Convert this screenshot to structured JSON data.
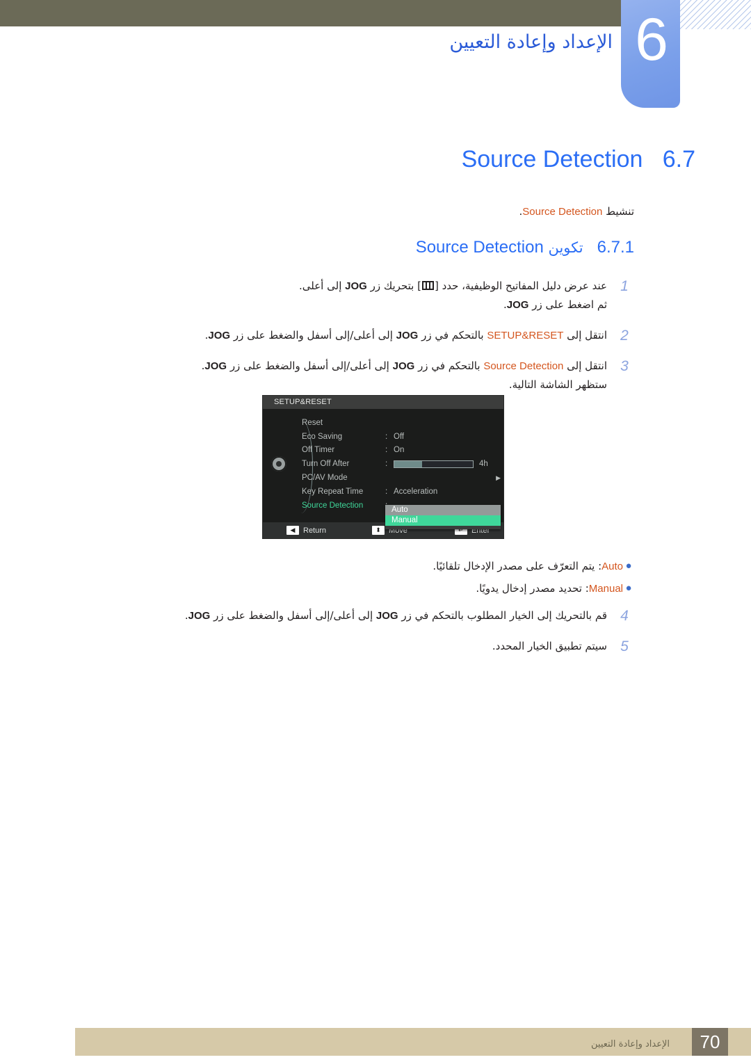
{
  "chapter": {
    "number": "6",
    "title": "الإعداد وإعادة التعيين"
  },
  "section": {
    "number": "6.7",
    "title": "Source Detection",
    "intro_prefix": "تنشيط ",
    "intro_highlight": "Source Detection",
    "intro_suffix": "."
  },
  "subsection": {
    "number": "6.7.1",
    "arabic": "تكوين ",
    "english": "Source Detection"
  },
  "steps": [
    {
      "num": "1",
      "line1_a": "عند عرض دليل المفاتيح الوظيفية، حدد [",
      "glyph": "menu-icon",
      "line1_b": "] بتحريك زر ",
      "line1_en": "JOG",
      "line1_c": " إلى أعلى.",
      "line2_a": "ثم اضغط على زر ",
      "line2_en": "JOG",
      "line2_c": "."
    },
    {
      "num": "2",
      "prefix": "انتقل إلى ",
      "highlight": "SETUP&RESET",
      "mid": " بالتحكم في زر ",
      "en1": "JOG",
      "mid2": " إلى أعلى/إلى أسفل والضغط على زر ",
      "en2": "JOG",
      "suffix": "."
    },
    {
      "num": "3",
      "prefix": "انتقل إلى ",
      "highlight": "Source Detection",
      "mid": " بالتحكم في زر ",
      "en1": "JOG",
      "mid2": " إلى أعلى/إلى أسفل والضغط على زر ",
      "en2": "JOG",
      "suffix": ".",
      "line2": "ستظهر الشاشة التالية."
    }
  ],
  "steps_tail": [
    {
      "num": "4",
      "prefix": "قم بالتحريك إلى الخيار المطلوب بالتحكم في زر ",
      "en1": "JOG",
      "mid2": " إلى أعلى/إلى أسفل والضغط على زر ",
      "en2": "JOG",
      "suffix": "."
    },
    {
      "num": "5",
      "prefix": "سيتم تطبيق الخيار المحدد.",
      "en1": "",
      "mid2": "",
      "en2": "",
      "suffix": ""
    }
  ],
  "osd": {
    "title": "SETUP&RESET",
    "rows": [
      {
        "label": "Reset",
        "colon": "",
        "value": "",
        "arrow": ""
      },
      {
        "label": "Eco Saving",
        "colon": ":",
        "value": "Off",
        "arrow": ""
      },
      {
        "label": "Off Timer",
        "colon": ":",
        "value": "On",
        "arrow": ""
      },
      {
        "label": "Turn Off After",
        "colon": ":",
        "value": "",
        "arrow": "",
        "slider": true,
        "slider_value": "4h",
        "slider_percent": 35
      },
      {
        "label": "PC/AV Mode",
        "colon": "",
        "value": "",
        "arrow": "▶"
      },
      {
        "label": "Key Repeat Time",
        "colon": ":",
        "value": "Acceleration",
        "arrow": ""
      },
      {
        "label": "Source Detection",
        "colon": ":",
        "value": "",
        "arrow": "",
        "active": true
      }
    ],
    "dropdown": {
      "options": [
        "Auto",
        "Manual"
      ],
      "selected": "Manual"
    },
    "footer": [
      {
        "icon": "◀",
        "icon_name": "return-icon",
        "label": "Return"
      },
      {
        "icon": "⬍",
        "icon_name": "move-icon",
        "label": "Move"
      },
      {
        "icon": "↵",
        "icon_name": "enter-icon",
        "label": "Enter"
      }
    ]
  },
  "bullets": [
    {
      "dot": "●",
      "highlight": "Auto",
      "text": ": يتم التعرّف على مصدر الإدخال تلقائيًا."
    },
    {
      "dot": "●",
      "highlight": "Manual",
      "text": ": تحديد مصدر إدخال يدويًا."
    }
  ],
  "footer": {
    "text": "الإعداد وإعادة التعيين",
    "page": "70"
  },
  "colors": {
    "accent_blue": "#2b6ef5",
    "highlight_orange": "#d4561f",
    "olive_bar": "#6b6a57",
    "chapter_tab": "#7ba0ea",
    "footer_bar": "#d6c9a8",
    "footer_page_box": "#7d7565",
    "osd_bg": "#1b1c1b",
    "osd_active_green": "#3fd79a"
  }
}
